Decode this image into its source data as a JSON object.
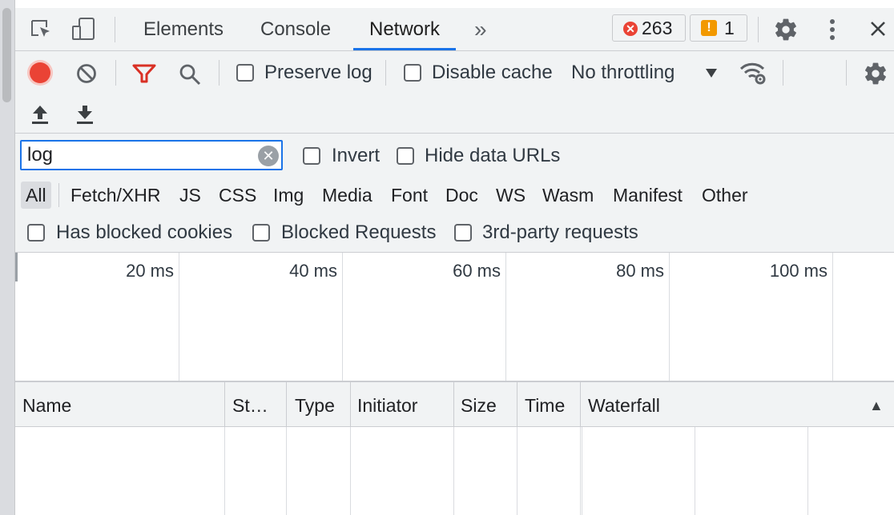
{
  "tabs": {
    "elements": "Elements",
    "console": "Console",
    "network": "Network",
    "more": "»"
  },
  "badges": {
    "errors": "263",
    "warnings": "1"
  },
  "toolbar": {
    "preserve_log": "Preserve log",
    "disable_cache": "Disable cache",
    "throttling": "No throttling"
  },
  "filter": {
    "value": "log",
    "invert": "Invert",
    "hide_data_urls": "Hide data URLs",
    "types": [
      "All",
      "Fetch/XHR",
      "JS",
      "CSS",
      "Img",
      "Media",
      "Font",
      "Doc",
      "WS",
      "Wasm",
      "Manifest",
      "Other"
    ],
    "has_blocked_cookies": "Has blocked cookies",
    "blocked_requests": "Blocked Requests",
    "third_party": "3rd-party requests"
  },
  "overview": {
    "ticks": [
      "20 ms",
      "40 ms",
      "60 ms",
      "80 ms",
      "100 ms"
    ]
  },
  "table": {
    "columns": [
      "Name",
      "St…",
      "Type",
      "Initiator",
      "Size",
      "Time",
      "Waterfall"
    ],
    "sort_indicator": "▲"
  },
  "colors": {
    "accent": "#1a73e8",
    "record": "#ea4335",
    "filter_active": "#d93025",
    "warning": "#f29900"
  }
}
